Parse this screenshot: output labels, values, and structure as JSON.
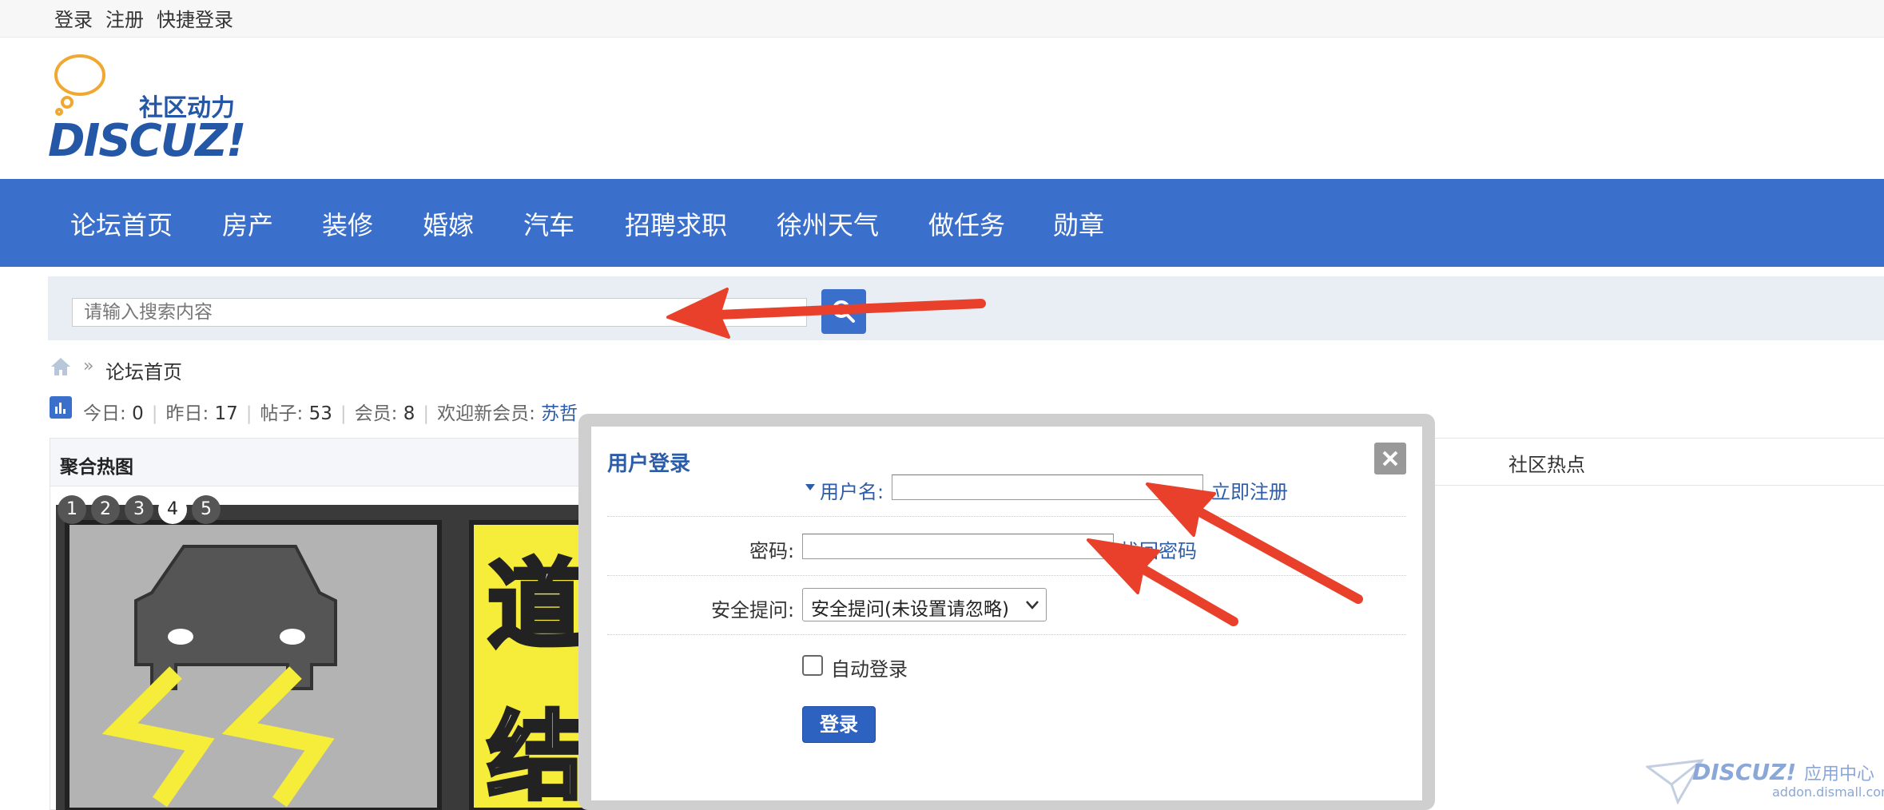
{
  "topbar": {
    "login": "登录",
    "register": "注册",
    "quick_login": "快捷登录"
  },
  "logo": {
    "tagline": "社区动力",
    "brand": "DISCUZ!"
  },
  "nav": {
    "items": [
      "论坛首页",
      "房产",
      "装修",
      "婚嫁",
      "汽车",
      "招聘求职",
      "徐州天气",
      "做任务",
      "勋章"
    ]
  },
  "search": {
    "placeholder": "请输入搜索内容"
  },
  "breadcrumb": {
    "separator": "»",
    "home": "论坛首页"
  },
  "stats": {
    "today_label": "今日: ",
    "today": "0",
    "yesterday_label": "昨日: ",
    "yesterday": "17",
    "posts_label": "帖子: ",
    "posts": "53",
    "members_label": "会员: ",
    "members": "8",
    "welcome_label": "欢迎新会员: ",
    "newest_member": "苏哲",
    "divider": "|"
  },
  "hot": {
    "title": "聚合热图",
    "pages": [
      "1",
      "2",
      "3",
      "4",
      "5"
    ],
    "active_page": "4",
    "sign_text": [
      "道",
      "结"
    ]
  },
  "right_panel": {
    "title": "社区热点"
  },
  "login_dialog": {
    "title": "用户登录",
    "username_label": "用户名:",
    "register_link": "立即注册",
    "password_label": "密码:",
    "forgot_link": "找回密码",
    "question_label": "安全提问:",
    "question_selected": "安全提问(未设置请忽略)",
    "auto_login": "自动登录",
    "submit": "登录"
  },
  "watermark": {
    "brand": "DISCUZ!",
    "suffix": "应用中心",
    "domain": "addon.dismall.com"
  },
  "colors": {
    "primary": "#3a6fcc",
    "link": "#2d5ca8",
    "arrow": "#e8402a"
  }
}
